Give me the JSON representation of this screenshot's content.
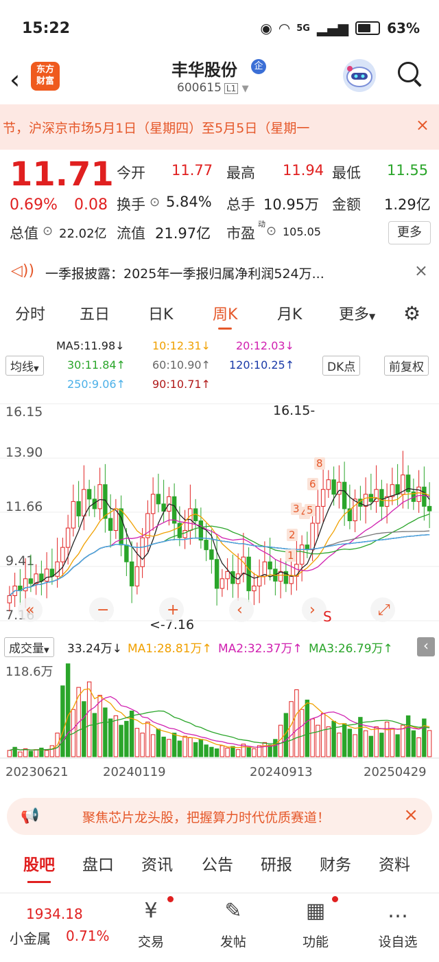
{
  "status_bar": {
    "time": "15:22",
    "network": "5G",
    "battery": "63%"
  },
  "header": {
    "logo_text": "东方财富",
    "stock_name": "丰华股份",
    "badge": "企",
    "code": "600615",
    "level": "L1"
  },
  "notice": {
    "text": "节，沪深京市场5月1日（星期四）至5月5日（星期一",
    "close": "×"
  },
  "quote": {
    "price": "11.71",
    "change_pct": "0.69%",
    "change": "0.08",
    "open_label": "今开",
    "open": "11.77",
    "high_label": "最高",
    "high": "11.94",
    "low_label": "最低",
    "low": "11.55",
    "turnover_label": "换手",
    "turnover": "5.84%",
    "volume_label": "总手",
    "volume": "10.95万",
    "amount_label": "金额",
    "amount": "1.29亿",
    "mktcap_label": "总值",
    "mktcap": "22.02亿",
    "float_label": "流值",
    "float": "21.97亿",
    "pe_label": "市盈",
    "pe_sup": "动",
    "pe": "105.05",
    "more": "更多"
  },
  "announcement": {
    "text": "一季报披露：2025年一季报归属净利润524万...",
    "close": "×"
  },
  "chart_tabs": [
    "分时",
    "五日",
    "日K",
    "周K",
    "月K",
    "更多"
  ],
  "active_tab": "周K",
  "ma_legend": {
    "ma5": "MA5:11.98↓",
    "ma10": "10:12.31↓",
    "ma20": "20:12.03↓",
    "ma30": "30:11.84↑",
    "ma60": "60:10.90↑",
    "ma120": "120:10.25↑",
    "ma250": "250:9.06↑",
    "ma90": "90:10.71↑",
    "indicator_btn": "均线",
    "dk_btn": "DK点",
    "adjust_btn": "前复权"
  },
  "colors": {
    "up": "#e02020",
    "down": "#2aa52a",
    "accent": "#e5582a"
  },
  "chart_data": [
    {
      "type": "candlestick",
      "title": "周K",
      "y_ticks": [
        "16.15",
        "13.90",
        "11.66",
        "9.41",
        "7.16"
      ],
      "ylim": [
        7.16,
        16.15
      ],
      "high_label": "16.15",
      "low_label": "<-7.16",
      "dk_markers": [
        "1",
        "2",
        "3",
        "4",
        "5",
        "6",
        "8"
      ],
      "closes": [
        8.2,
        8.6,
        8.4,
        8.9,
        8.7,
        9.1,
        8.8,
        9.3,
        9.0,
        9.6,
        10.2,
        11.0,
        12.1,
        11.5,
        12.6,
        12.2,
        11.8,
        12.8,
        11.4,
        10.9,
        11.8,
        10.3,
        9.6,
        8.6,
        9.4,
        10.6,
        11.6,
        12.4,
        12.0,
        11.7,
        12.3,
        11.2,
        10.6,
        10.9,
        11.8,
        11.3,
        10.5,
        10.1,
        9.7,
        8.5,
        8.9,
        9.2,
        8.7,
        9.1,
        9.8,
        8.4,
        8.6,
        9.0,
        9.6,
        9.3,
        8.8,
        9.2,
        8.7,
        9.0,
        9.5,
        10.3,
        10.1,
        11.2,
        11.9,
        12.6,
        13.0,
        12.4,
        12.9,
        11.8,
        11.3,
        12.2,
        11.9,
        12.4,
        12.1,
        12.6,
        11.9,
        12.3,
        12.8,
        12.4,
        13.2,
        12.5,
        12.1,
        12.7,
        11.9,
        11.71
      ]
    },
    {
      "type": "bar",
      "title": "成交量",
      "ylabel_max": "118.6万",
      "x_labels": [
        "20230621",
        "20240119",
        "20240913",
        "20250429"
      ],
      "legend": {
        "vol": "33.24万↓",
        "ma1": "MA1:28.81万↑",
        "ma2": "MA2:32.37万↑",
        "ma3": "MA3:26.79万↑"
      },
      "ylim": [
        0,
        118.6
      ],
      "values": [
        8,
        12,
        6,
        10,
        7,
        9,
        11,
        8,
        14,
        30,
        90,
        118,
        60,
        88,
        70,
        95,
        55,
        78,
        62,
        48,
        52,
        40,
        45,
        58,
        36,
        30,
        44,
        28,
        35,
        25,
        22,
        30,
        20,
        26,
        24,
        18,
        22,
        15,
        12,
        10,
        14,
        11,
        13,
        9,
        16,
        12,
        10,
        14,
        18,
        15,
        22,
        40,
        55,
        70,
        85,
        60,
        72,
        48,
        40,
        55,
        38,
        45,
        30,
        42,
        35,
        28,
        50,
        33,
        26,
        38,
        30,
        44,
        36,
        28,
        40,
        52,
        33,
        24,
        48,
        33.24
      ],
      "up": [
        true,
        false,
        true,
        true,
        false,
        true,
        false,
        true,
        true,
        true,
        false,
        false,
        true,
        true,
        false,
        true,
        false,
        true,
        false,
        false,
        true,
        false,
        false,
        false,
        true,
        true,
        true,
        true,
        false,
        false,
        true,
        false,
        false,
        true,
        true,
        false,
        false,
        false,
        false,
        false,
        true,
        true,
        false,
        true,
        true,
        false,
        true,
        true,
        true,
        false,
        false,
        true,
        false,
        true,
        true,
        true,
        false,
        true,
        true,
        true,
        true,
        false,
        true,
        false,
        false,
        true,
        false,
        true,
        false,
        true,
        false,
        true,
        true,
        false,
        true,
        false,
        false,
        true,
        false,
        true
      ]
    }
  ],
  "nav_controls": [
    "«",
    "−",
    "+",
    "‹",
    "›",
    "S",
    "⤢"
  ],
  "ad": {
    "text": "聚焦芯片龙头股，把握算力时代优质赛道！",
    "close": "×"
  },
  "bottom_tabs": [
    "股吧",
    "盘口",
    "资讯",
    "公告",
    "研报",
    "财务",
    "资料"
  ],
  "bottom_nav": {
    "index_value": "1934.18",
    "index_name": "小金属",
    "index_change": "0.71%",
    "items": [
      {
        "label": "交易",
        "icon": "¥"
      },
      {
        "label": "发帖",
        "icon": "✎"
      },
      {
        "label": "功能",
        "icon": "▦"
      },
      {
        "label": "设自选",
        "icon": "…"
      }
    ]
  }
}
